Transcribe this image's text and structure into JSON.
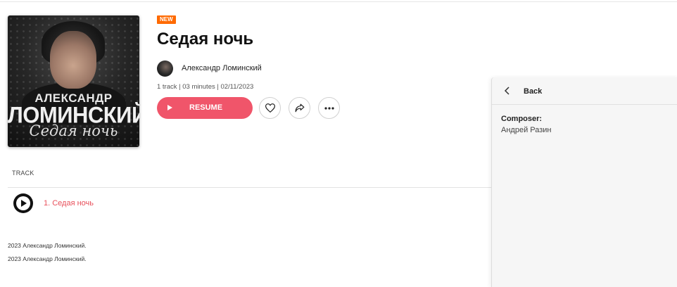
{
  "release": {
    "badge": "NEW",
    "title": "Седая ночь",
    "artist": "Александр Ломинский",
    "meta": "1 track  |  03 minutes  |  02/11/2023",
    "cover": {
      "line1": "АЛЕКСАНДР",
      "line2": "ЛОМИНСКИЙ",
      "line3": "Седая ночь"
    }
  },
  "actions": {
    "resume_label": "RESUME",
    "like_icon": "heart-icon",
    "share_icon": "share-icon",
    "more_icon": "more-icon"
  },
  "tracklist": {
    "header": "TRACK",
    "tracks": [
      {
        "name": "1. Седая ночь"
      }
    ]
  },
  "footer": {
    "copyright_lines": [
      "2023 Александр Ломинский.",
      "2023 Александр Ломинский."
    ]
  },
  "side_panel": {
    "back_label": "Back",
    "composer_label": "Composer:",
    "composer_value": "Андрей Разин"
  },
  "colors": {
    "accent": "#f0556a",
    "track_active": "#e8505b",
    "badge": "#ff6a00"
  }
}
